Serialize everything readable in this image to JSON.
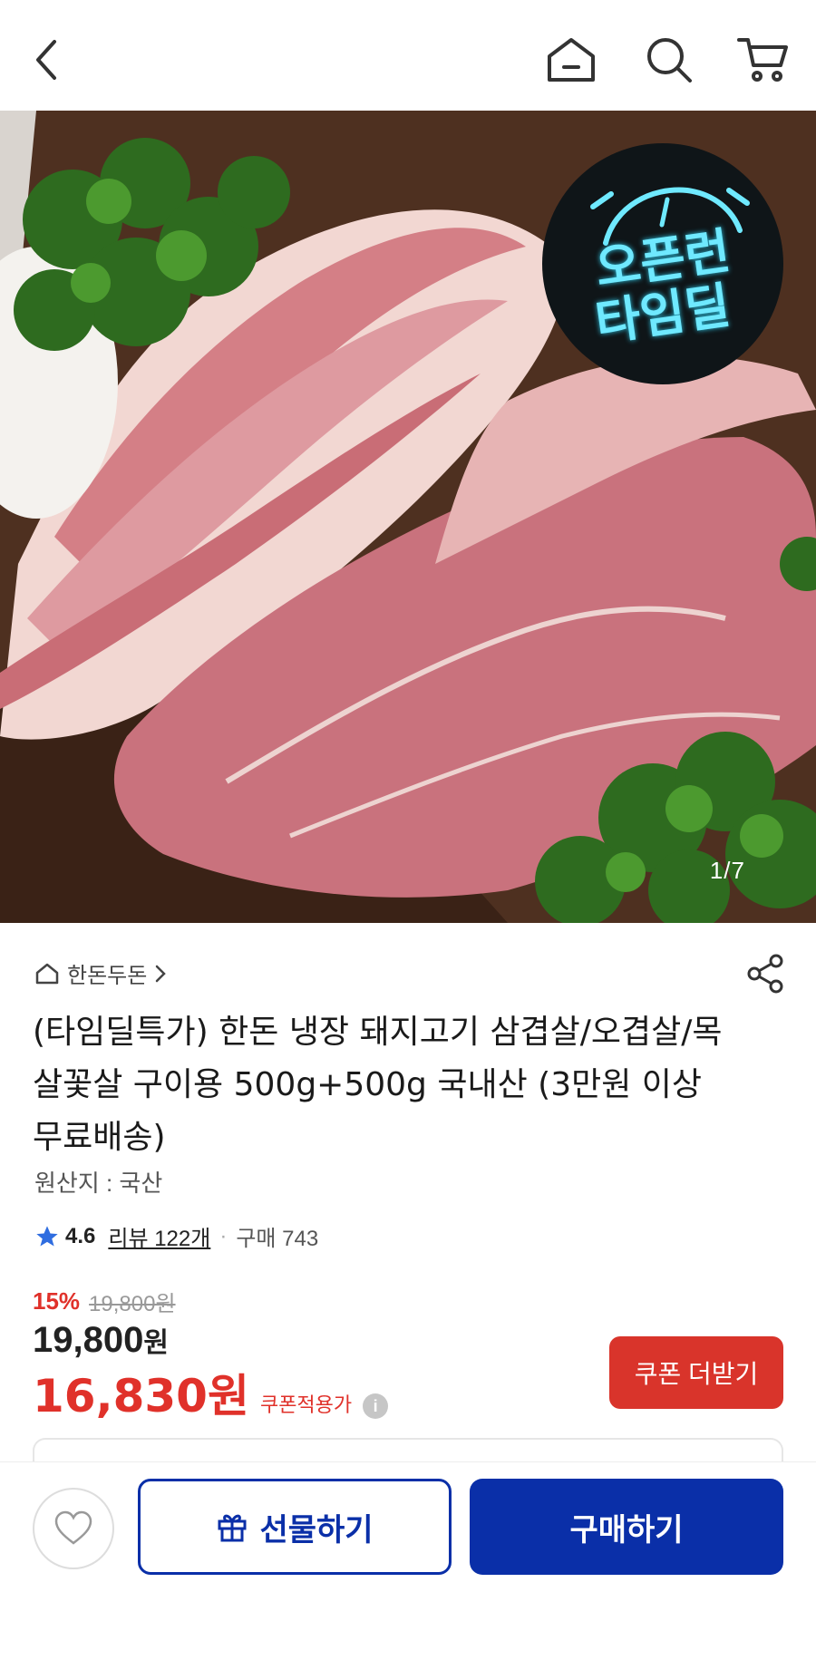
{
  "header": {
    "back_icon": "chevron-left-icon",
    "home_icon": "home-icon",
    "search_icon": "search-icon",
    "cart_icon": "cart-icon"
  },
  "hero": {
    "badge_line1": "오픈런",
    "badge_line2": "타임딜",
    "counter": "1/7"
  },
  "product": {
    "store_name": "한돈두돈",
    "title": "(타임딜특가) 한돈 냉장 돼지고기 삼겹살/오겹살/목살꽃살 구이용 500g+500g 국내산 (3만원 이상 무료배송)",
    "origin": "원산지 : 국산",
    "rating": "4.6",
    "review_label": "리뷰 122개",
    "purchase_label": "구매 743",
    "discount_rate": "15%",
    "original_price": "19,800원",
    "price_number": "19,800",
    "price_unit": "원",
    "coupon_price": "16,830원",
    "coupon_label": "쿠폰적용가",
    "info_icon": "i",
    "coupon_button": "쿠폰 더받기"
  },
  "bottom": {
    "gift_button": "선물하기",
    "buy_button": "구매하기"
  },
  "colors": {
    "accent_red": "#d9342b",
    "primary_blue": "#0a2fa8"
  }
}
